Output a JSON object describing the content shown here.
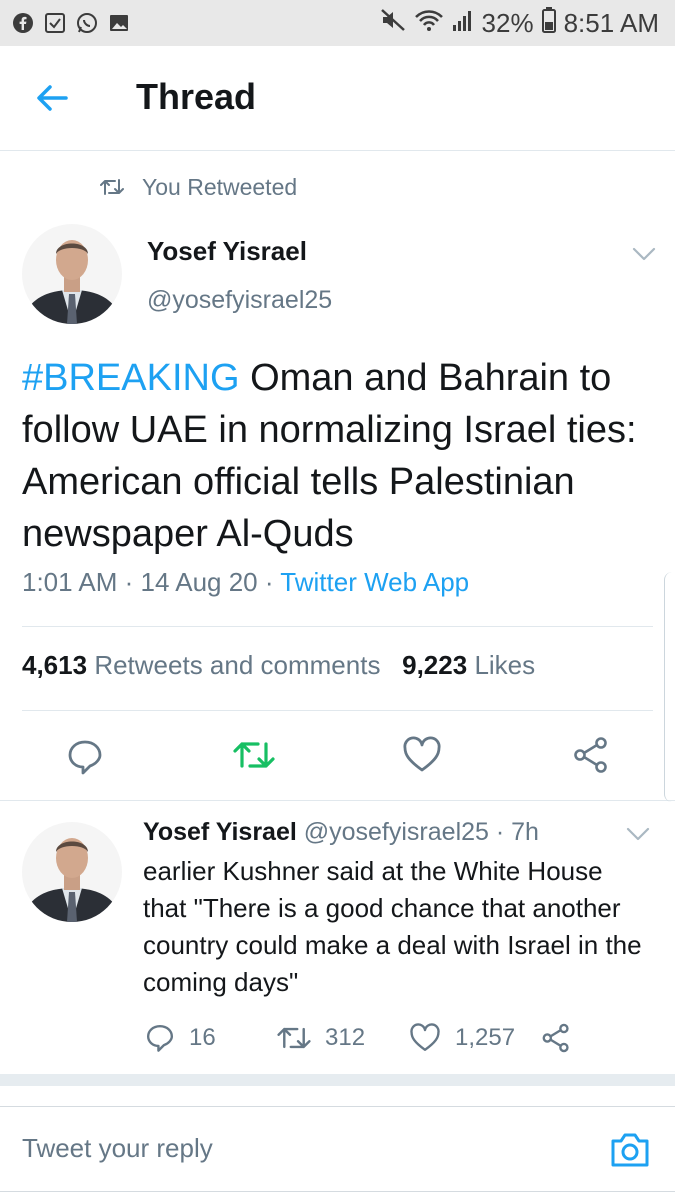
{
  "status_bar": {
    "battery": "32%",
    "time": "8:51 AM",
    "icons": [
      "facebook-icon",
      "checkbox-icon",
      "whatsapp-icon",
      "image-icon",
      "mute-icon",
      "wifi-icon",
      "signal-icon",
      "battery-icon"
    ]
  },
  "header": {
    "title": "Thread"
  },
  "main_tweet": {
    "retweet_label": "You Retweeted",
    "name": "Yosef Yisrael",
    "handle": "@yosefyisrael25",
    "hashtag": "#BREAKING",
    "text": " Oman and Bahrain to follow UAE in normalizing Israel ties: American official tells Palestinian newspaper Al-Quds",
    "time": "1:01 AM",
    "date": "14 Aug 20",
    "source": "Twitter Web App",
    "retweets_count": "4,613",
    "retweets_label": "Retweets and comments",
    "likes_count": "9,223",
    "likes_label": "Likes"
  },
  "reply_tweet": {
    "name": "Yosef Yisrael",
    "handle": "@yosefyisrael25",
    "age": "7h",
    "text": "earlier Kushner said at the White House that \"There is a good chance that another country could make a deal with Israel in the coming days\"",
    "replies": "16",
    "retweets": "312",
    "likes": "1,257"
  },
  "composer": {
    "placeholder": "Tweet your reply"
  },
  "colors": {
    "accent": "#1da1f2",
    "retweet_green": "#17bf63",
    "text": "#14171a",
    "muted": "#657786"
  }
}
